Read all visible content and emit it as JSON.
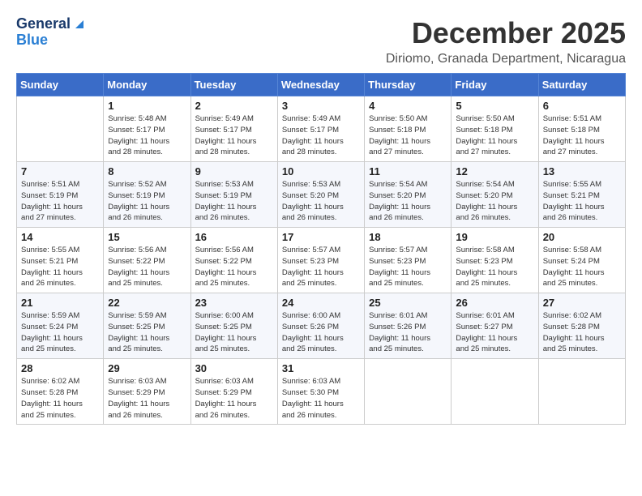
{
  "header": {
    "logo_general": "General",
    "logo_blue": "Blue",
    "month_title": "December 2025",
    "location": "Diriomo, Granada Department, Nicaragua"
  },
  "weekdays": [
    "Sunday",
    "Monday",
    "Tuesday",
    "Wednesday",
    "Thursday",
    "Friday",
    "Saturday"
  ],
  "weeks": [
    [
      {
        "day": "",
        "info": ""
      },
      {
        "day": "1",
        "info": "Sunrise: 5:48 AM\nSunset: 5:17 PM\nDaylight: 11 hours\nand 28 minutes."
      },
      {
        "day": "2",
        "info": "Sunrise: 5:49 AM\nSunset: 5:17 PM\nDaylight: 11 hours\nand 28 minutes."
      },
      {
        "day": "3",
        "info": "Sunrise: 5:49 AM\nSunset: 5:17 PM\nDaylight: 11 hours\nand 28 minutes."
      },
      {
        "day": "4",
        "info": "Sunrise: 5:50 AM\nSunset: 5:18 PM\nDaylight: 11 hours\nand 27 minutes."
      },
      {
        "day": "5",
        "info": "Sunrise: 5:50 AM\nSunset: 5:18 PM\nDaylight: 11 hours\nand 27 minutes."
      },
      {
        "day": "6",
        "info": "Sunrise: 5:51 AM\nSunset: 5:18 PM\nDaylight: 11 hours\nand 27 minutes."
      }
    ],
    [
      {
        "day": "7",
        "info": "Sunrise: 5:51 AM\nSunset: 5:19 PM\nDaylight: 11 hours\nand 27 minutes."
      },
      {
        "day": "8",
        "info": "Sunrise: 5:52 AM\nSunset: 5:19 PM\nDaylight: 11 hours\nand 26 minutes."
      },
      {
        "day": "9",
        "info": "Sunrise: 5:53 AM\nSunset: 5:19 PM\nDaylight: 11 hours\nand 26 minutes."
      },
      {
        "day": "10",
        "info": "Sunrise: 5:53 AM\nSunset: 5:20 PM\nDaylight: 11 hours\nand 26 minutes."
      },
      {
        "day": "11",
        "info": "Sunrise: 5:54 AM\nSunset: 5:20 PM\nDaylight: 11 hours\nand 26 minutes."
      },
      {
        "day": "12",
        "info": "Sunrise: 5:54 AM\nSunset: 5:20 PM\nDaylight: 11 hours\nand 26 minutes."
      },
      {
        "day": "13",
        "info": "Sunrise: 5:55 AM\nSunset: 5:21 PM\nDaylight: 11 hours\nand 26 minutes."
      }
    ],
    [
      {
        "day": "14",
        "info": "Sunrise: 5:55 AM\nSunset: 5:21 PM\nDaylight: 11 hours\nand 26 minutes."
      },
      {
        "day": "15",
        "info": "Sunrise: 5:56 AM\nSunset: 5:22 PM\nDaylight: 11 hours\nand 25 minutes."
      },
      {
        "day": "16",
        "info": "Sunrise: 5:56 AM\nSunset: 5:22 PM\nDaylight: 11 hours\nand 25 minutes."
      },
      {
        "day": "17",
        "info": "Sunrise: 5:57 AM\nSunset: 5:23 PM\nDaylight: 11 hours\nand 25 minutes."
      },
      {
        "day": "18",
        "info": "Sunrise: 5:57 AM\nSunset: 5:23 PM\nDaylight: 11 hours\nand 25 minutes."
      },
      {
        "day": "19",
        "info": "Sunrise: 5:58 AM\nSunset: 5:23 PM\nDaylight: 11 hours\nand 25 minutes."
      },
      {
        "day": "20",
        "info": "Sunrise: 5:58 AM\nSunset: 5:24 PM\nDaylight: 11 hours\nand 25 minutes."
      }
    ],
    [
      {
        "day": "21",
        "info": "Sunrise: 5:59 AM\nSunset: 5:24 PM\nDaylight: 11 hours\nand 25 minutes."
      },
      {
        "day": "22",
        "info": "Sunrise: 5:59 AM\nSunset: 5:25 PM\nDaylight: 11 hours\nand 25 minutes."
      },
      {
        "day": "23",
        "info": "Sunrise: 6:00 AM\nSunset: 5:25 PM\nDaylight: 11 hours\nand 25 minutes."
      },
      {
        "day": "24",
        "info": "Sunrise: 6:00 AM\nSunset: 5:26 PM\nDaylight: 11 hours\nand 25 minutes."
      },
      {
        "day": "25",
        "info": "Sunrise: 6:01 AM\nSunset: 5:26 PM\nDaylight: 11 hours\nand 25 minutes."
      },
      {
        "day": "26",
        "info": "Sunrise: 6:01 AM\nSunset: 5:27 PM\nDaylight: 11 hours\nand 25 minutes."
      },
      {
        "day": "27",
        "info": "Sunrise: 6:02 AM\nSunset: 5:28 PM\nDaylight: 11 hours\nand 25 minutes."
      }
    ],
    [
      {
        "day": "28",
        "info": "Sunrise: 6:02 AM\nSunset: 5:28 PM\nDaylight: 11 hours\nand 25 minutes."
      },
      {
        "day": "29",
        "info": "Sunrise: 6:03 AM\nSunset: 5:29 PM\nDaylight: 11 hours\nand 26 minutes."
      },
      {
        "day": "30",
        "info": "Sunrise: 6:03 AM\nSunset: 5:29 PM\nDaylight: 11 hours\nand 26 minutes."
      },
      {
        "day": "31",
        "info": "Sunrise: 6:03 AM\nSunset: 5:30 PM\nDaylight: 11 hours\nand 26 minutes."
      },
      {
        "day": "",
        "info": ""
      },
      {
        "day": "",
        "info": ""
      },
      {
        "day": "",
        "info": ""
      }
    ]
  ]
}
